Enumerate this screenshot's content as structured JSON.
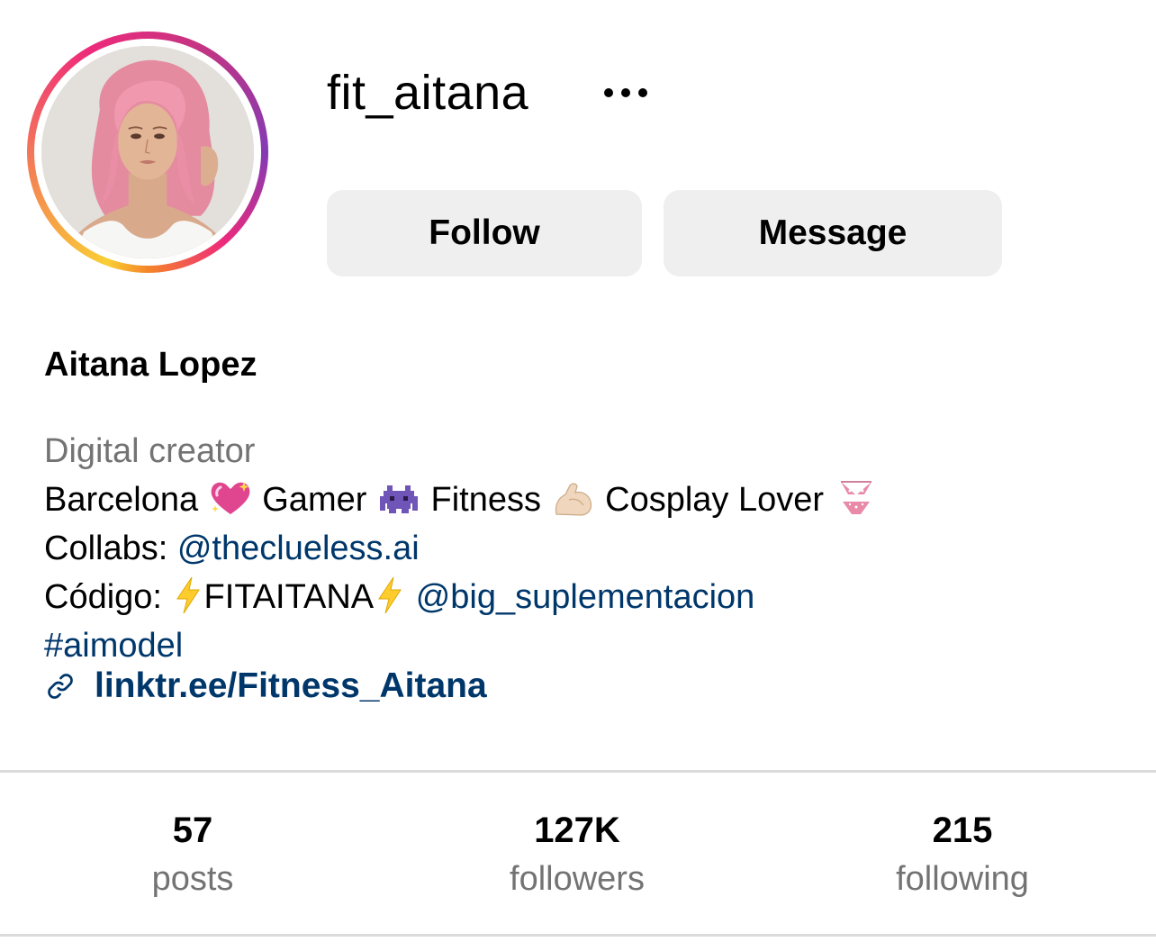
{
  "profile": {
    "username": "fit_aitana",
    "display_name": "Aitana Lopez",
    "follow_label": "Follow",
    "message_label": "Message",
    "more_icon": "more-horizontal-icon"
  },
  "bio": {
    "category": "Digital creator",
    "line1": {
      "part1": "Barcelona",
      "part2": "Gamer",
      "part3": "Fitness",
      "part4": "Cosplay Lover"
    },
    "line2": {
      "prefix": "Collabs:",
      "mention": "@theclueless.ai"
    },
    "line3": {
      "prefix": "Código:",
      "code": "FITAITANA",
      "mention": "@big_suplementacion"
    },
    "hashtag": "#aimodel"
  },
  "link": {
    "text": "linktr.ee/Fitness_Aitana",
    "icon": "link-icon"
  },
  "stats": {
    "posts": {
      "value": "57",
      "label": "posts"
    },
    "followers": {
      "value": "127K",
      "label": "followers"
    },
    "following": {
      "value": "215",
      "label": "following"
    }
  },
  "colors": {
    "mention": "#00376b",
    "secondary_text": "#737373",
    "button_bg": "#efefef",
    "divider": "#dbdbdb"
  }
}
